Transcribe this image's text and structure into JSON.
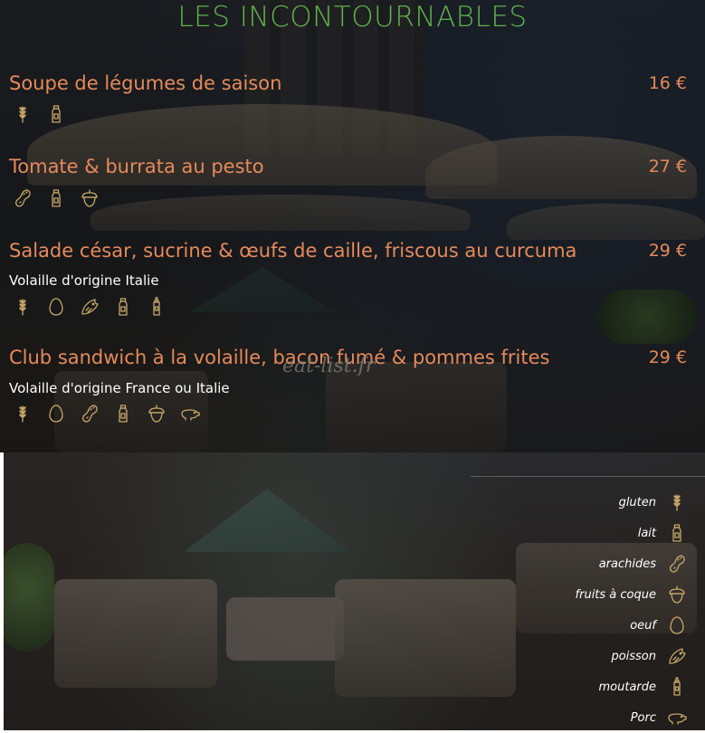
{
  "menu": {
    "title": "LES INCONTOURNABLES",
    "watermark": "eat-list.fr",
    "dishes": [
      {
        "name": "Soupe de légumes de saison",
        "price": "16 €",
        "origin": "",
        "allergens": [
          "gluten-icon",
          "lait-icon"
        ]
      },
      {
        "name": "Tomate & burrata au pesto",
        "price": "27 €",
        "origin": "",
        "allergens": [
          "arachides-icon",
          "lait-icon",
          "fruits-a-coque-icon"
        ]
      },
      {
        "name": "Salade césar, sucrine & œufs de caille, friscous au curcuma",
        "price": "29 €",
        "origin": "Volaille d'origine Italie",
        "allergens": [
          "gluten-icon",
          "oeuf-icon",
          "poisson-icon",
          "lait-icon",
          "moutarde-icon"
        ]
      },
      {
        "name": "Club sandwich à la volaille, bacon fumé & pommes frites",
        "price": "29 €",
        "origin": "Volaille d'origine France ou Italie",
        "allergens": [
          "gluten-icon",
          "oeuf-icon",
          "arachides-icon",
          "lait-icon",
          "fruits-a-coque-icon",
          "porc-icon"
        ]
      }
    ]
  },
  "legend": [
    {
      "label": "gluten",
      "icon": "gluten-icon"
    },
    {
      "label": "lait",
      "icon": "lait-icon"
    },
    {
      "label": "arachides",
      "icon": "arachides-icon"
    },
    {
      "label": "fruits à coque",
      "icon": "fruits-a-coque-icon"
    },
    {
      "label": "oeuf",
      "icon": "oeuf-icon"
    },
    {
      "label": "poisson",
      "icon": "poisson-icon"
    },
    {
      "label": "moutarde",
      "icon": "moutarde-icon"
    },
    {
      "label": "Porc",
      "icon": "porc-icon"
    }
  ],
  "colors": {
    "title": "#5fb14b",
    "dish": "#e58a5a",
    "icon": "#c9a968",
    "text": "#ffffff"
  }
}
